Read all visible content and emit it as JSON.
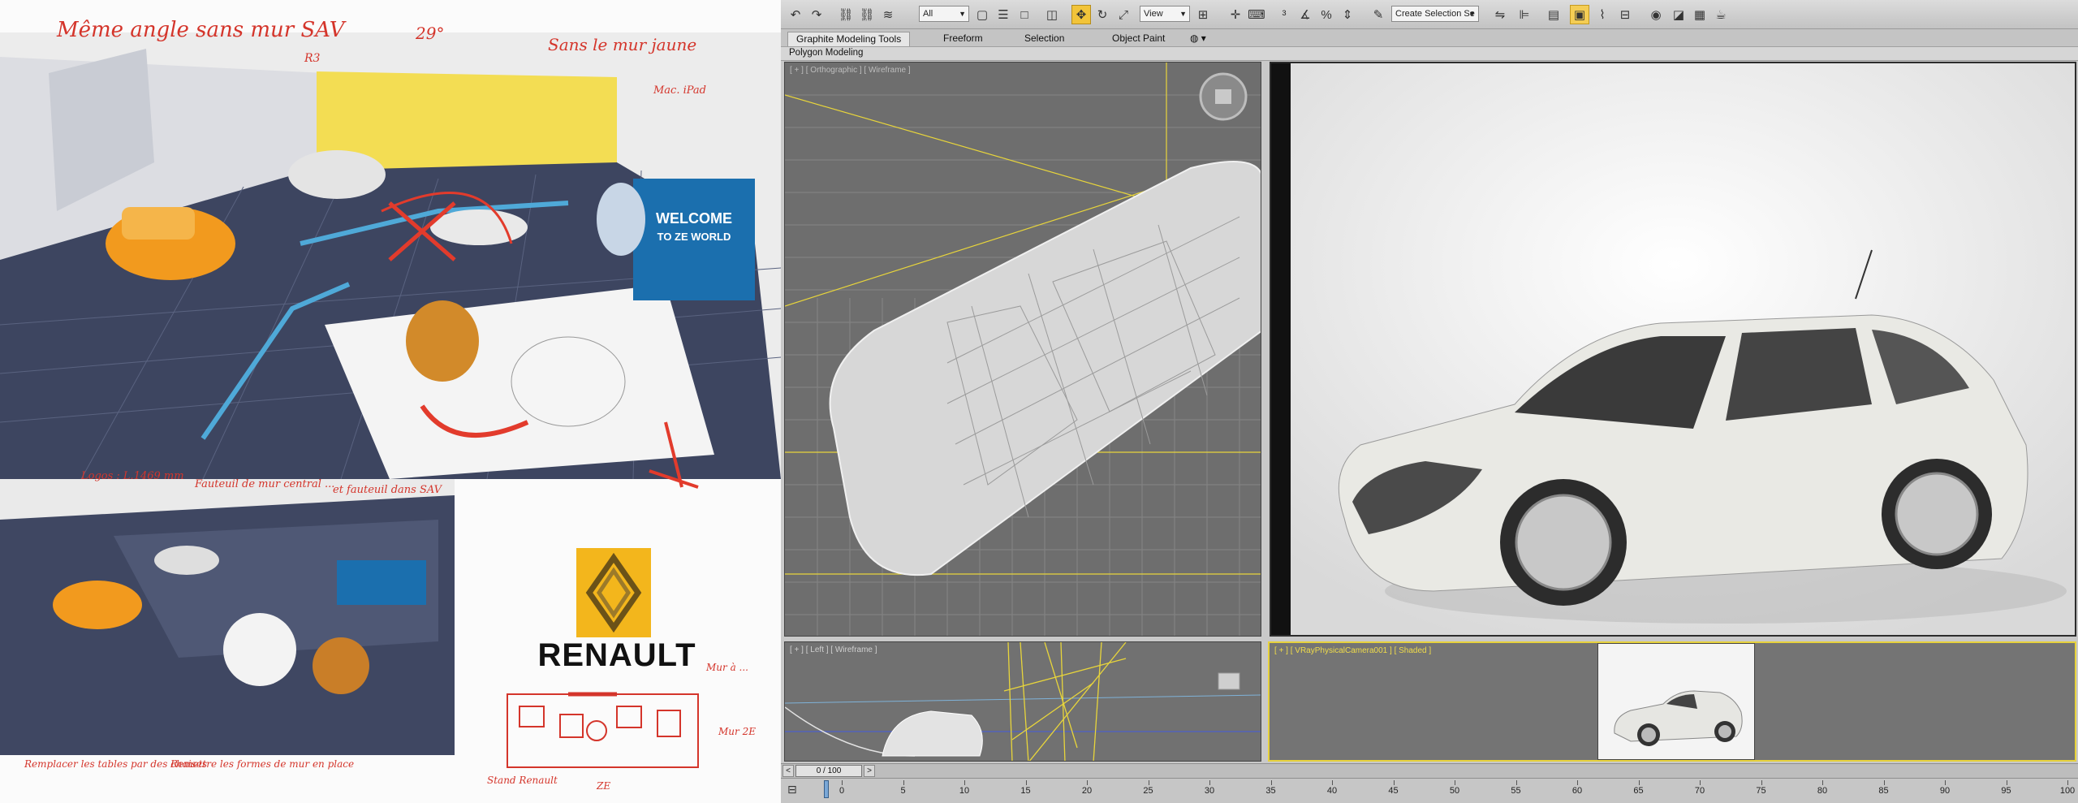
{
  "sheet": {
    "notes": {
      "top_left": "Même angle sans mur SAV",
      "angle": "29°",
      "mark": "R3",
      "top_right": "Sans le mur jaune",
      "ipad": "Mac. iPad",
      "mid1": "Logos : L.1469 mm",
      "mid2": "Fauteuil de mur central ...",
      "mid3": "et fauteuil dans SAV",
      "bottom_left": "Remplacer les tables par des chaises",
      "bottom_mid": "Remettre les formes de mur en place",
      "plan1": "Mur à ...",
      "plan2": "Mur 2E",
      "plan3": "Stand Renault",
      "plan4": "ZE"
    },
    "banner": {
      "line1": "WELCOME",
      "line2": "TO ZE WORLD"
    },
    "logo": {
      "word": "RENAULT",
      "color": "#f3b61c"
    }
  },
  "app": {
    "toolbar": {
      "filter_select": "All",
      "coord_select": "View",
      "named_selection": "Create Selection Se",
      "icons": [
        "undo-icon",
        "redo-icon",
        "link-icon",
        "unlink-icon",
        "bind-spacewarp-icon",
        "select-object-icon",
        "select-by-name-icon",
        "rect-region-icon",
        "window-crossing-icon",
        "move-icon",
        "rotate-icon",
        "scale-icon",
        "use-pivot-icon",
        "select-manipulate-icon",
        "keyboard-shortcut-icon",
        "snap-3d-icon",
        "angle-snap-icon",
        "percent-snap-icon",
        "spinner-snap-icon",
        "edit-named-selection-icon",
        "mirror-icon",
        "align-icon",
        "layer-manager-icon",
        "graphite-toggle-icon",
        "curve-editor-icon",
        "schematic-view-icon",
        "material-editor-icon",
        "render-setup-icon",
        "rendered-frame-icon",
        "render-production-icon"
      ]
    },
    "ribbon": {
      "tabs": [
        "Graphite Modeling Tools",
        "Freeform",
        "Selection",
        "Object Paint"
      ],
      "active_tab": "Graphite Modeling Tools",
      "panel_label": "Polygon Modeling"
    },
    "viewports": {
      "top": "[ + ] [ Orthographic ] [ Wireframe ]",
      "left": "[ + ] [ Left ] [ Wireframe ]",
      "camera": "[ + ] [ VRayPhysicalCamera001 ] [ Shaded ]"
    },
    "time": {
      "frame": "0 / 100",
      "prev": "<",
      "next": ">"
    },
    "trackbar": {
      "ticks": [
        "0",
        "5",
        "10",
        "15",
        "20",
        "25",
        "30",
        "35",
        "40",
        "45",
        "50",
        "55",
        "60",
        "65",
        "70",
        "75",
        "80",
        "85",
        "90",
        "95",
        "100"
      ]
    },
    "colors": {
      "active_button": "#f2c43a",
      "active_viewport_border": "#e7d23c",
      "wire_yellow": "#e8d53b"
    }
  }
}
